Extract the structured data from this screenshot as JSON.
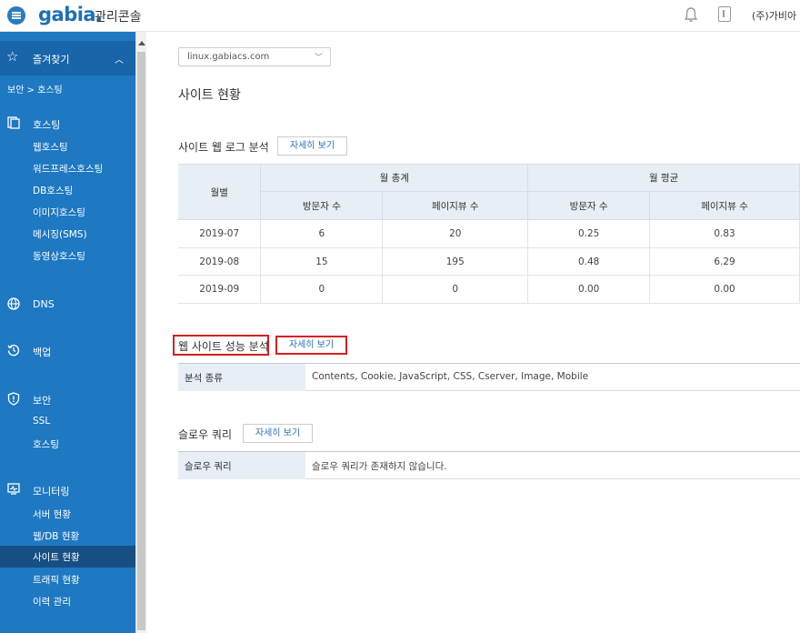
{
  "header": {
    "logo": "gabia.",
    "console_title": "관리콘솔",
    "user_name": "(주)가비아 ˅"
  },
  "sidebar": {
    "favorites_label": "즐겨찾기",
    "breadcrumb": "보안 > 호스팅",
    "sections": {
      "hosting": {
        "label": "호스팅",
        "items": [
          "웹호스팅",
          "워드프레스호스팅",
          "DB호스팅",
          "이미지호스팅",
          "메시징(SMS)",
          "동영상호스팅"
        ]
      },
      "dns": {
        "label": "DNS"
      },
      "backup": {
        "label": "백업"
      },
      "security": {
        "label": "보안",
        "items": [
          "SSL",
          "호스팅"
        ]
      },
      "monitoring": {
        "label": "모니터링",
        "items": [
          "서버 현황",
          "웹/DB 현황",
          "사이트 현황",
          "트래픽 현황",
          "이력 관리"
        ]
      }
    },
    "active_item": "사이트 현황",
    "accent_color": "#1e78c2"
  },
  "main": {
    "server_select": "linux.gabiacs.com",
    "page_title": "사이트 현황",
    "weblog": {
      "title": "사이트 웹 로그 분석",
      "button": "자세히 보기",
      "headers": {
        "month": "월별",
        "monthly_total": "월 총계",
        "monthly_avg": "월 평균",
        "visitors": "방문자 수",
        "pageviews": "페이지뷰 수"
      },
      "rows": [
        {
          "month": "2019-07",
          "total_visitors": "6",
          "total_pageviews": "20",
          "avg_visitors": "0.25",
          "avg_pageviews": "0.83"
        },
        {
          "month": "2019-08",
          "total_visitors": "15",
          "total_pageviews": "195",
          "avg_visitors": "0.48",
          "avg_pageviews": "6.29"
        },
        {
          "month": "2019-09",
          "total_visitors": "0",
          "total_pageviews": "0",
          "avg_visitors": "0.00",
          "avg_pageviews": "0.00"
        }
      ]
    },
    "performance": {
      "title": "웹 사이트 성능 분석",
      "button": "자세히 보기",
      "key": "분석 종류",
      "value": "Contents, Cookie, JavaScript, CSS, Cserver, Image, Mobile"
    },
    "slow_query": {
      "title": "슬로우 쿼리",
      "button": "자세히 보기",
      "key": "슬로우 쿼리",
      "value": "슬로우 쿼리가 존재하지 않습니다."
    }
  }
}
